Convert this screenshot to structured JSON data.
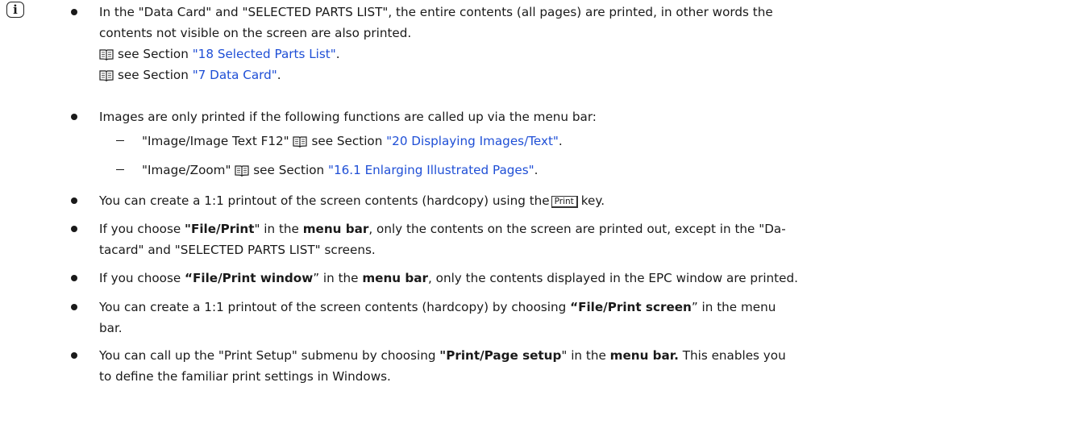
{
  "icon": "info-icon",
  "colors": {
    "text": "#1a1a1a",
    "link": "#1f4fd6"
  },
  "b1": {
    "line1": "In the \"Data Card\" and \"SELECTED PARTS LIST\", the entire contents (all pages) are printed, in other words the",
    "line2": "contents not visible on the screen are also printed.",
    "ref1_pre": "see Section ",
    "ref1_link": "\"18 Selected Parts List\"",
    "ref1_post": ".",
    "ref2_pre": "see Section ",
    "ref2_link": "\"7 Data Card\"",
    "ref2_post": "."
  },
  "b2": {
    "text": "Images are only printed if the following functions are called up via the menu bar:",
    "d1_pre": "\"Image/Image Text F12\" ",
    "d1_mid": "see Section ",
    "d1_link": "\"20 Displaying Images/Text\"",
    "d1_post": ".",
    "d2_pre": "\"Image/Zoom\" ",
    "d2_mid": "see Section ",
    "d2_link": "\"16.1 Enlarging Illustrated Pages\"",
    "d2_post": "."
  },
  "b3": {
    "pre": "You can create a 1:1 printout of the screen contents (hardcopy) using the",
    "key": "Print",
    "post": "key."
  },
  "b4": {
    "l1_a": "If you choose ",
    "l1_b": "\"File/Print",
    "l1_c": "\" in the ",
    "l1_d": "menu bar",
    "l1_e": ", only the contents on the screen are printed out, except in the \"Da-",
    "l2": "tacard\" and \"SELECTED PARTS LIST\" screens."
  },
  "b5": {
    "a": "If you choose ",
    "b": "“File/Print window",
    "c": "” in the ",
    "d": "menu bar",
    "e": ", only the contents displayed in the EPC window are printed."
  },
  "b6": {
    "l1_a": "You can create a 1:1 printout of the screen contents (hardcopy) by choosing ",
    "l1_b": "“File/Print screen",
    "l1_c": "” in the menu",
    "l2": "bar."
  },
  "b7": {
    "l1_a": "You can call up the \"Print Setup\" submenu by choosing ",
    "l1_b": "\"Print/Page setup",
    "l1_c": "\" in the ",
    "l1_d": "menu bar.",
    "l1_e": " This enables you",
    "l2": "to define the familiar print settings in Windows."
  }
}
